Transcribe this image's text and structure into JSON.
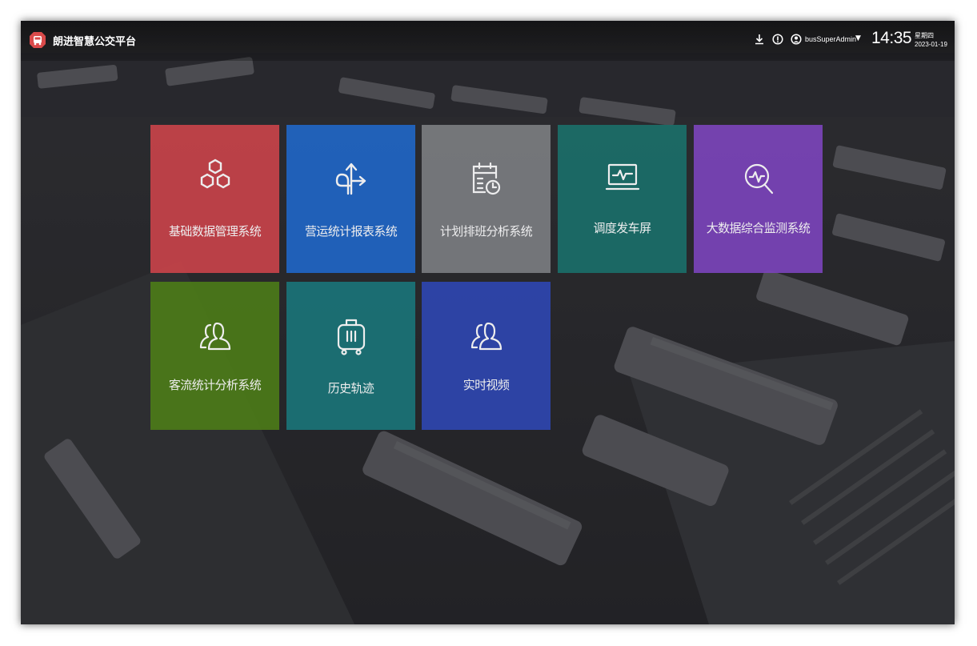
{
  "header": {
    "app_title": "朗进智慧公交平台",
    "logo_icon": "bus-logo-icon",
    "username": "busSuperAdmin",
    "time": "14:35",
    "weekday": "星期四",
    "date": "2023-01-19",
    "icons": [
      "download-icon",
      "info-icon",
      "user-icon",
      "caret-down-icon"
    ]
  },
  "tiles": [
    {
      "label": "基础数据管理系统",
      "color": "#c8434a",
      "icon": "hexagons-icon"
    },
    {
      "label": "营运统计报表系统",
      "color": "#2166c4",
      "icon": "route-arrows-icon"
    },
    {
      "label": "计划排班分析系统",
      "color": "#7b7d80",
      "icon": "calendar-clock-icon"
    },
    {
      "label": "调度发车屏",
      "color": "#1b6f69",
      "icon": "monitor-pulse-icon"
    },
    {
      "label": "大数据综合监测系统",
      "color": "#7b44b9",
      "icon": "search-pulse-icon"
    },
    {
      "label": "客流统计分析系统",
      "color": "#4c7a19",
      "icon": "users-icon"
    },
    {
      "label": "历史轨迹",
      "color": "#1b7478",
      "icon": "luggage-icon"
    },
    {
      "label": "实时视频",
      "color": "#2f46b0",
      "icon": "users-icon"
    }
  ]
}
